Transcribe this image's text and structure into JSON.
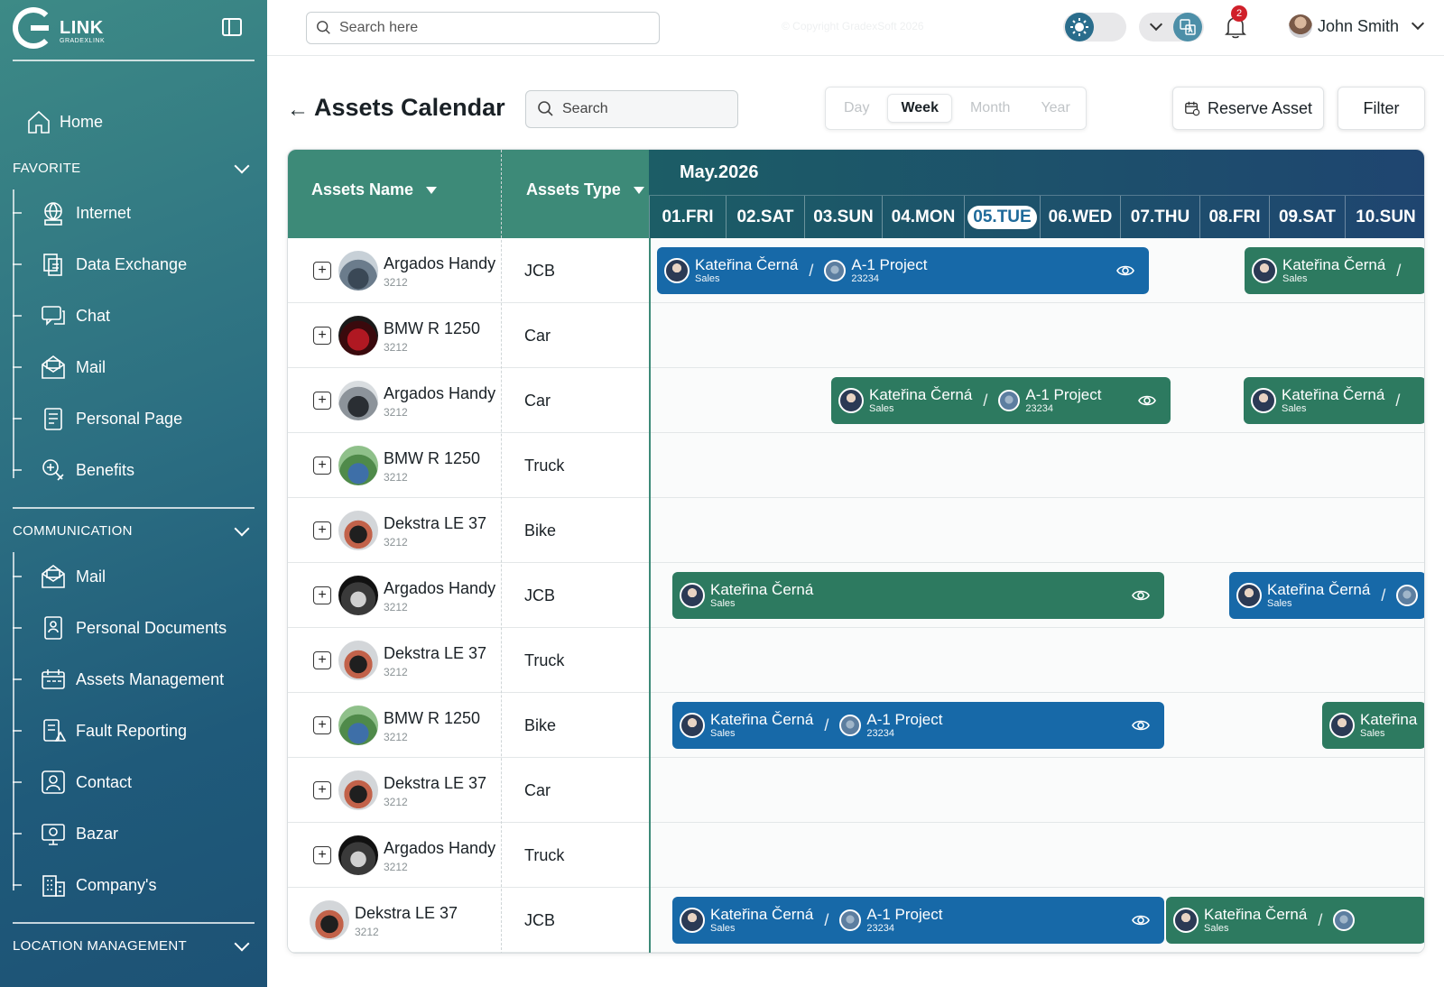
{
  "app": {
    "logo_text": "LINK",
    "logo_sub": "GRADEXLINK",
    "copyright": "© Copyright GradexSoft 2026"
  },
  "sidebar": {
    "home_label": "Home",
    "sections": [
      {
        "title": "FAVORITE",
        "items": [
          {
            "label": "Internet",
            "icon": "globe-icon"
          },
          {
            "label": "Data Exchange",
            "icon": "data-exchange-icon"
          },
          {
            "label": "Chat",
            "icon": "chat-icon"
          },
          {
            "label": "Mail",
            "icon": "mail-icon"
          },
          {
            "label": "Personal Page",
            "icon": "personal-page-icon"
          },
          {
            "label": "Benefits",
            "icon": "benefits-icon"
          }
        ]
      },
      {
        "title": "COMMUNICATION",
        "items": [
          {
            "label": "Mail",
            "icon": "mail-icon"
          },
          {
            "label": "Personal Documents",
            "icon": "documents-icon"
          },
          {
            "label": "Assets Management",
            "icon": "assets-icon"
          },
          {
            "label": "Fault Reporting",
            "icon": "fault-icon"
          },
          {
            "label": "Contact",
            "icon": "contact-icon"
          },
          {
            "label": "Bazar",
            "icon": "bazar-icon"
          },
          {
            "label": "Company's",
            "icon": "company-icon"
          }
        ]
      },
      {
        "title": "LOCATION MANAGEMENT",
        "items": []
      }
    ]
  },
  "topbar": {
    "search_placeholder": "Search here",
    "notification_count": "2",
    "user_name": "John Smith"
  },
  "page": {
    "title": "Assets Calendar",
    "search_placeholder": "Search",
    "range_tabs": [
      "Day",
      "Week",
      "Month",
      "Year"
    ],
    "active_range": "Week",
    "reserve_label": "Reserve Asset",
    "filter_label": "Filter"
  },
  "calendar": {
    "col_name": "Assets Name",
    "col_type": "Assets Type",
    "month": "May.2026",
    "days": [
      "01.FRI",
      "02.SAT",
      "03.SUN",
      "04.MON",
      "05.TUE",
      "06.WED",
      "07.THU",
      "08.FRI",
      "09.SAT",
      "10.SUN"
    ],
    "today": "05.TUE",
    "rows": [
      {
        "name": "Argados Handy",
        "id": "3212",
        "type": "JCB"
      },
      {
        "name": "BMW R 1250",
        "id": "3212",
        "type": "Car"
      },
      {
        "name": "Argados Handy",
        "id": "3212",
        "type": "Car"
      },
      {
        "name": "BMW R 1250",
        "id": "3212",
        "type": "Truck"
      },
      {
        "name": "Dekstra LE  37",
        "id": "3212",
        "type": "Bike"
      },
      {
        "name": "Argados Handy",
        "id": "3212",
        "type": "JCB"
      },
      {
        "name": "Dekstra LE  37",
        "id": "3212",
        "type": "Truck"
      },
      {
        "name": "BMW R 1250",
        "id": "3212",
        "type": "Bike"
      },
      {
        "name": "Dekstra LE  37",
        "id": "3212",
        "type": "Car"
      },
      {
        "name": "Argados Handy",
        "id": "3212",
        "type": "Truck"
      },
      {
        "name": "Dekstra LE  37",
        "id": "3212",
        "type": "JCB"
      }
    ],
    "event_person": "Kateřina Černá",
    "event_role": "Sales",
    "event_project": "A-1 Project",
    "event_project_id": "23234",
    "event_person_short": "Kateřina",
    "colors": {
      "blue": "#1769a8",
      "green": "#2d7a60",
      "header": "#3d8a78"
    }
  }
}
